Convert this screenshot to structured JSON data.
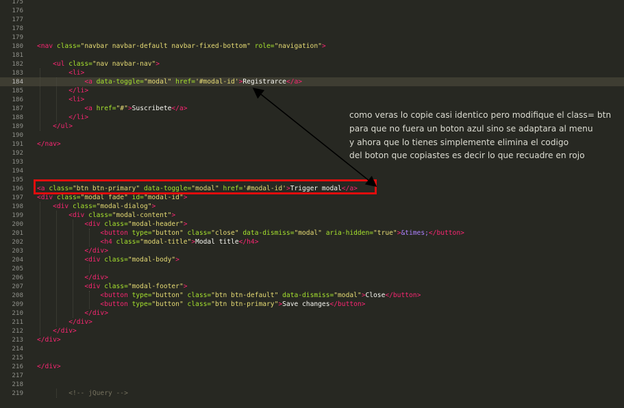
{
  "editor": {
    "lines": [
      {
        "n": "175",
        "code": []
      },
      {
        "n": "176",
        "code": []
      },
      {
        "n": "177",
        "code": []
      },
      {
        "n": "178",
        "code": []
      },
      {
        "n": "179",
        "code": []
      },
      {
        "n": "180",
        "code": [
          [
            "tag",
            "<"
          ],
          [
            "tag",
            "nav"
          ],
          [
            "attr",
            " class="
          ],
          [
            "str",
            "\"navbar navbar-default navbar-fixed-bottom\""
          ],
          [
            "attr",
            " role="
          ],
          [
            "str",
            "\"navigation\""
          ],
          [
            "tag",
            ">"
          ]
        ]
      },
      {
        "n": "181",
        "code": []
      },
      {
        "n": "182",
        "code": [
          [
            "txt",
            "    "
          ],
          [
            "tag",
            "<ul"
          ],
          [
            "attr",
            " class="
          ],
          [
            "str",
            "\"nav navbar-nav\""
          ],
          [
            "tag",
            ">"
          ]
        ]
      },
      {
        "n": "183",
        "code": [
          [
            "txt",
            "        "
          ],
          [
            "tag",
            "<li>"
          ]
        ]
      },
      {
        "n": "184",
        "current": true,
        "code": [
          [
            "txt",
            "            "
          ],
          [
            "tag",
            "<a"
          ],
          [
            "attr",
            " data-toggle="
          ],
          [
            "str",
            "\"modal\""
          ],
          [
            "attr",
            " href="
          ],
          [
            "str",
            "'#modal-id'"
          ],
          [
            "tag",
            ">"
          ],
          [
            "txt",
            "Registrarce"
          ],
          [
            "tag",
            "</a>"
          ]
        ]
      },
      {
        "n": "185",
        "code": [
          [
            "txt",
            "        "
          ],
          [
            "tag",
            "</li>"
          ]
        ]
      },
      {
        "n": "186",
        "code": [
          [
            "txt",
            "        "
          ],
          [
            "tag",
            "<li>"
          ]
        ]
      },
      {
        "n": "187",
        "code": [
          [
            "txt",
            "            "
          ],
          [
            "tag",
            "<a"
          ],
          [
            "attr",
            " href="
          ],
          [
            "str",
            "\"#\""
          ],
          [
            "tag",
            ">"
          ],
          [
            "txt",
            "Suscribete"
          ],
          [
            "tag",
            "</a>"
          ]
        ]
      },
      {
        "n": "188",
        "code": [
          [
            "txt",
            "        "
          ],
          [
            "tag",
            "</li>"
          ]
        ]
      },
      {
        "n": "189",
        "code": [
          [
            "txt",
            "    "
          ],
          [
            "tag",
            "</ul>"
          ]
        ]
      },
      {
        "n": "190",
        "code": []
      },
      {
        "n": "191",
        "code": [
          [
            "tag",
            "</nav>"
          ]
        ]
      },
      {
        "n": "192",
        "code": []
      },
      {
        "n": "193",
        "code": []
      },
      {
        "n": "194",
        "code": []
      },
      {
        "n": "195",
        "code": []
      },
      {
        "n": "196",
        "code": [
          [
            "tag",
            "<a"
          ],
          [
            "attr",
            " class="
          ],
          [
            "str",
            "\"btn btn-primary\""
          ],
          [
            "attr",
            " data-toggle="
          ],
          [
            "str",
            "\"modal\""
          ],
          [
            "attr",
            " href="
          ],
          [
            "str",
            "'#modal-id'"
          ],
          [
            "tag",
            ">"
          ],
          [
            "txt",
            "Trigger modal"
          ],
          [
            "tag",
            "</a>"
          ]
        ]
      },
      {
        "n": "197",
        "code": [
          [
            "tag",
            "<div"
          ],
          [
            "attr",
            " class="
          ],
          [
            "str",
            "\"modal fade\""
          ],
          [
            "attr",
            " id="
          ],
          [
            "str",
            "\"modal-id\""
          ],
          [
            "tag",
            ">"
          ]
        ]
      },
      {
        "n": "198",
        "code": [
          [
            "txt",
            "    "
          ],
          [
            "tag",
            "<div"
          ],
          [
            "attr",
            " class="
          ],
          [
            "str",
            "\"modal-dialog\""
          ],
          [
            "tag",
            ">"
          ]
        ]
      },
      {
        "n": "199",
        "code": [
          [
            "txt",
            "        "
          ],
          [
            "tag",
            "<div"
          ],
          [
            "attr",
            " class="
          ],
          [
            "str",
            "\"modal-content\""
          ],
          [
            "tag",
            ">"
          ]
        ]
      },
      {
        "n": "200",
        "code": [
          [
            "txt",
            "            "
          ],
          [
            "tag",
            "<div"
          ],
          [
            "attr",
            " class="
          ],
          [
            "str",
            "\"modal-header\""
          ],
          [
            "tag",
            ">"
          ]
        ]
      },
      {
        "n": "201",
        "code": [
          [
            "txt",
            "                "
          ],
          [
            "tag",
            "<button"
          ],
          [
            "attr",
            " type="
          ],
          [
            "str",
            "\"button\""
          ],
          [
            "attr",
            " class="
          ],
          [
            "str",
            "\"close\""
          ],
          [
            "attr",
            " data-dismiss="
          ],
          [
            "str",
            "\"modal\""
          ],
          [
            "attr",
            " aria-hidden="
          ],
          [
            "str",
            "\"true\""
          ],
          [
            "tag",
            ">"
          ],
          [
            "ent",
            "&times;"
          ],
          [
            "tag",
            "</button>"
          ]
        ]
      },
      {
        "n": "202",
        "code": [
          [
            "txt",
            "                "
          ],
          [
            "tag",
            "<h4"
          ],
          [
            "attr",
            " class="
          ],
          [
            "str",
            "\"modal-title\""
          ],
          [
            "tag",
            ">"
          ],
          [
            "txt",
            "Modal title"
          ],
          [
            "tag",
            "</h4>"
          ]
        ]
      },
      {
        "n": "203",
        "code": [
          [
            "txt",
            "            "
          ],
          [
            "tag",
            "</div>"
          ]
        ]
      },
      {
        "n": "204",
        "code": [
          [
            "txt",
            "            "
          ],
          [
            "tag",
            "<div"
          ],
          [
            "attr",
            " class="
          ],
          [
            "str",
            "\"modal-body\""
          ],
          [
            "tag",
            ">"
          ]
        ]
      },
      {
        "n": "205",
        "code": []
      },
      {
        "n": "206",
        "code": [
          [
            "txt",
            "            "
          ],
          [
            "tag",
            "</div>"
          ]
        ]
      },
      {
        "n": "207",
        "code": [
          [
            "txt",
            "            "
          ],
          [
            "tag",
            "<div"
          ],
          [
            "attr",
            " class="
          ],
          [
            "str",
            "\"modal-footer\""
          ],
          [
            "tag",
            ">"
          ]
        ]
      },
      {
        "n": "208",
        "code": [
          [
            "txt",
            "                "
          ],
          [
            "tag",
            "<button"
          ],
          [
            "attr",
            " type="
          ],
          [
            "str",
            "\"button\""
          ],
          [
            "attr",
            " class="
          ],
          [
            "str",
            "\"btn btn-default\""
          ],
          [
            "attr",
            " data-dismiss="
          ],
          [
            "str",
            "\"modal\""
          ],
          [
            "tag",
            ">"
          ],
          [
            "txt",
            "Close"
          ],
          [
            "tag",
            "</button>"
          ]
        ]
      },
      {
        "n": "209",
        "code": [
          [
            "txt",
            "                "
          ],
          [
            "tag",
            "<button"
          ],
          [
            "attr",
            " type="
          ],
          [
            "str",
            "\"button\""
          ],
          [
            "attr",
            " class="
          ],
          [
            "str",
            "\"btn btn-primary\""
          ],
          [
            "tag",
            ">"
          ],
          [
            "txt",
            "Save changes"
          ],
          [
            "tag",
            "</button>"
          ]
        ]
      },
      {
        "n": "210",
        "code": [
          [
            "txt",
            "            "
          ],
          [
            "tag",
            "</div>"
          ]
        ]
      },
      {
        "n": "211",
        "code": [
          [
            "txt",
            "        "
          ],
          [
            "tag",
            "</div>"
          ]
        ]
      },
      {
        "n": "212",
        "code": [
          [
            "txt",
            "    "
          ],
          [
            "tag",
            "</div>"
          ]
        ]
      },
      {
        "n": "213",
        "code": [
          [
            "tag",
            "</div>"
          ]
        ]
      },
      {
        "n": "214",
        "code": []
      },
      {
        "n": "215",
        "code": []
      },
      {
        "n": "216",
        "code": [
          [
            "tag",
            "</div>"
          ]
        ]
      },
      {
        "n": "217",
        "code": []
      },
      {
        "n": "218",
        "code": []
      },
      {
        "n": "219",
        "code": [
          [
            "txt",
            "        "
          ],
          [
            "comment",
            "<!-- jQuery -->"
          ]
        ]
      }
    ]
  },
  "annotation": {
    "lines": [
      "como veras lo copie casi identico pero modifique el class= btn",
      "para que no fuera un boton azul sino se adaptara al menu",
      "y ahora que lo tienes simplemente elimina el codigo",
      "del boton que copiastes es decir lo que recuadre en rojo"
    ]
  },
  "colors": {
    "background": "#272822",
    "highlight_box": "#e00d0d",
    "arrow": "#000000"
  }
}
